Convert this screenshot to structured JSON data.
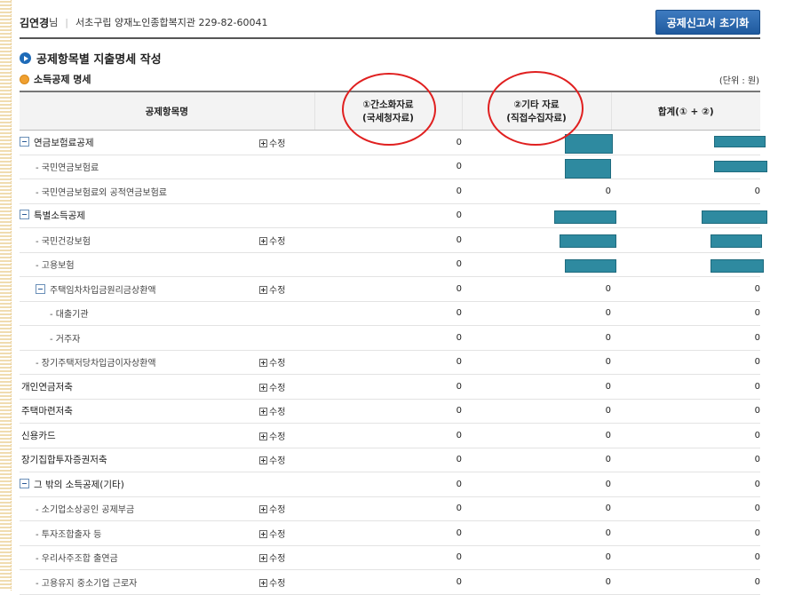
{
  "user": {
    "name": "김연경",
    "suffix": "님",
    "organization": "서초구립 양재노인종합복지관 229-82-60041"
  },
  "reset_button": "공제신고서 초기화",
  "section_title": "공제항목별 지출명세 작성",
  "sub_title": "소득공제 명세",
  "unit": "(단위 : 원)",
  "columns": {
    "item": "공제항목명",
    "simple_line1": "①간소화자료",
    "simple_line2": "(국세청자료)",
    "other_line1": "②기타 자료",
    "other_line2": "(직접수집자료)",
    "sum": "합계(① + ②)"
  },
  "edit_label": "수정",
  "rows": [
    {
      "label": "연금보험료공제",
      "simple": "0",
      "other": "",
      "sum": ""
    },
    {
      "label": "- 국민연금보험료",
      "simple": "0",
      "other": "",
      "sum": ""
    },
    {
      "label": "- 국민연금보험료외 공적연금보험료",
      "simple": "0",
      "other": "0",
      "sum": "0"
    },
    {
      "label": "특별소득공제",
      "simple": "0",
      "other": "",
      "sum": ""
    },
    {
      "label": "- 국민건강보험",
      "simple": "0",
      "other": "",
      "sum": ""
    },
    {
      "label": "- 고용보험",
      "simple": "0",
      "other": "",
      "sum": ""
    },
    {
      "label": "주택임차차입금원리금상환액",
      "simple": "0",
      "other": "0",
      "sum": "0"
    },
    {
      "label": "- 대출기관",
      "simple": "0",
      "other": "0",
      "sum": "0"
    },
    {
      "label": "- 거주자",
      "simple": "0",
      "other": "0",
      "sum": "0"
    },
    {
      "label": "- 장기주택저당차입금이자상환액",
      "simple": "0",
      "other": "0",
      "sum": "0"
    },
    {
      "label": "개인연금저축",
      "simple": "0",
      "other": "0",
      "sum": "0"
    },
    {
      "label": "주택마련저축",
      "simple": "0",
      "other": "0",
      "sum": "0"
    },
    {
      "label": "신용카드",
      "simple": "0",
      "other": "0",
      "sum": "0"
    },
    {
      "label": "장기집합투자증권저축",
      "simple": "0",
      "other": "0",
      "sum": "0"
    },
    {
      "label": "그 밖의 소득공제(기타)",
      "simple": "0",
      "other": "0",
      "sum": "0"
    },
    {
      "label": "- 소기업소상공인 공제부금",
      "simple": "0",
      "other": "0",
      "sum": "0"
    },
    {
      "label": "- 투자조합출자 등",
      "simple": "0",
      "other": "0",
      "sum": "0"
    },
    {
      "label": "- 우리사주조합 출연금",
      "simple": "0",
      "other": "0",
      "sum": "0"
    },
    {
      "label": "- 고용유지 중소기업 근로자",
      "simple": "0",
      "other": "0",
      "sum": "0"
    }
  ],
  "colors": {
    "button_bg": "#2a66ad",
    "redaction": "#2e8aa0",
    "annotation": "#e02020"
  }
}
